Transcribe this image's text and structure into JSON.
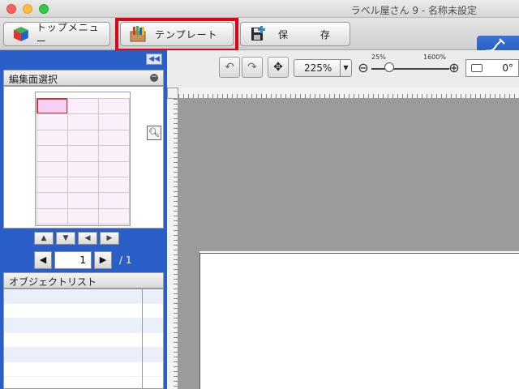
{
  "window": {
    "title": "ラベル屋さん 9 - 名称未設定"
  },
  "toolbar": {
    "top_menu_label": "トップメニュー",
    "template_label": "テンプレート",
    "save_label": "保 存",
    "highlight_color": "#e60012"
  },
  "left_panel": {
    "edit_section_title": "編集面選択",
    "page_current": "1",
    "page_total": "/ 1",
    "object_list_title": "オブジェクトリスト"
  },
  "options": {
    "zoom_value": "225%",
    "slider_min_label": "25%",
    "slider_max_label": "1600%",
    "rotation_value": "0°"
  },
  "icons": [
    "cube-icon",
    "template-icon",
    "save-icon",
    "pen-icon",
    "undo-icon",
    "redo-icon",
    "fit-icon",
    "zoom-out-icon",
    "zoom-in-icon",
    "magnify-icon"
  ]
}
